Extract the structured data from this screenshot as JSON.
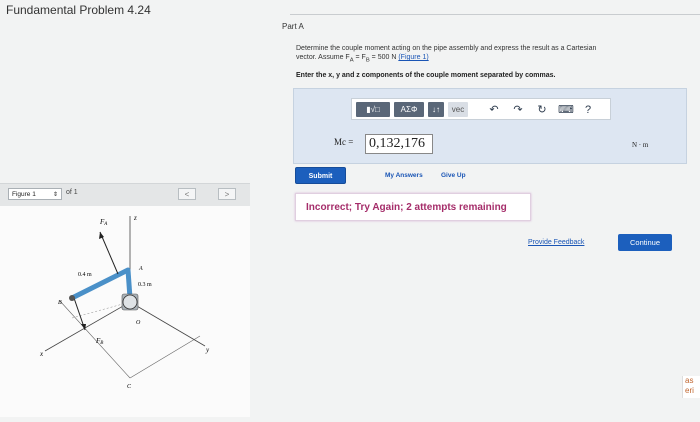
{
  "page": {
    "title": "Fundamental Problem 4.24"
  },
  "figure_nav": {
    "select_value": "Figure 1",
    "of_text": "of 1",
    "prev": "<",
    "next": ">"
  },
  "figure": {
    "labels": {
      "fa": "F",
      "fa_sub": "A",
      "z": "z",
      "d1": "0.4 m",
      "a": "A",
      "d2": "0.3 m",
      "b": "B",
      "o": "O",
      "fb": "F",
      "fb_sub": "B",
      "x": "x",
      "y": "y",
      "c": "C"
    }
  },
  "part": {
    "label": "Part A",
    "prompt_line1": "Determine the couple moment acting on the pipe assembly and express the result as a Cartesian",
    "prompt_line2": "vector. Assume F",
    "prompt_fa_sub": "A",
    "prompt_eq1": " = F",
    "prompt_fb_sub": "B",
    "prompt_eq2": " = 500 N ",
    "prompt_link": "(Figure 1)",
    "instruction": "Enter the x, y and z components of the couple moment separated by commas."
  },
  "toolbar": {
    "templates": "▮√□",
    "greek": "ΑΣΦ",
    "updown": "↓↑",
    "vec": "vec",
    "undo": "↶",
    "redo": "↷",
    "reset": "↻",
    "keyboard": "⌨",
    "help": "?"
  },
  "answer": {
    "label": "Mc =",
    "value": "0,132,176",
    "unit": "N · m"
  },
  "actions": {
    "submit": "Submit",
    "my_answers": "My Answers",
    "give_up": "Give Up"
  },
  "feedback": {
    "message": "Incorrect; Try Again; 2 attempts remaining"
  },
  "footer": {
    "provide_feedback": "Provide Feedback",
    "continue": "Continue"
  },
  "edge_tab": {
    "line1": "as",
    "line2": "eri"
  }
}
